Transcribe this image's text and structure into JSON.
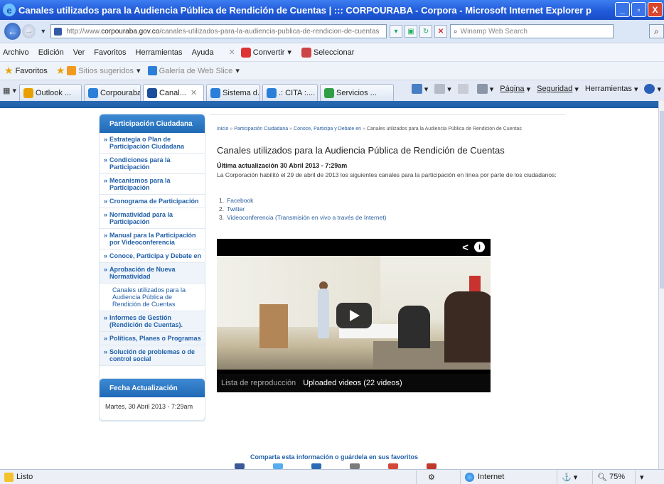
{
  "window": {
    "title": "Canales utilizados para la Audiencia Pública de Rendición de Cuentas | ::: CORPOURABA - Corpora - Microsoft Internet Explorer p",
    "minimize": "_",
    "maximize": "▫",
    "close": "X"
  },
  "address": {
    "prefix": "http://www.",
    "domain": "corpouraba.gov.co",
    "path": "/canales-utilizados-para-la-audiencia-publica-de-rendicion-de-cuentas",
    "search_placeholder": "Winamp Web Search"
  },
  "menubar": {
    "items": [
      "Archivo",
      "Edición",
      "Ver",
      "Favoritos",
      "Herramientas",
      "Ayuda"
    ],
    "convertir": "Convertir",
    "seleccionar": "Seleccionar"
  },
  "favorites": {
    "label": "Favoritos",
    "sitios": "Sitios sugeridos",
    "galeria": "Galería de Web Slice"
  },
  "tabs": [
    {
      "label": "Outlook ...",
      "color": "#e8a000"
    },
    {
      "label": "Corpouraba",
      "color": "#2b7fd8"
    },
    {
      "label": "Canal...",
      "color": "#1b4f9e"
    },
    {
      "label": "Sistema d...",
      "color": "#2b7fd8"
    },
    {
      "label": ".: CITA :....",
      "color": "#2b7fd8"
    },
    {
      "label": "Servicios ...",
      "color": "#2f9e44"
    }
  ],
  "commandbar": {
    "pagina": "Página",
    "seguridad": "Seguridad",
    "herramientas": "Herramientas"
  },
  "sidebar": {
    "title": "Participación Ciudadana",
    "items": [
      {
        "label": "Estrategia o Plan de Participación Ciudadana",
        "kind": "top"
      },
      {
        "label": "Condiciones para la Participación",
        "kind": "top"
      },
      {
        "label": "Mecanismos para la Participación",
        "kind": "top"
      },
      {
        "label": "Cronograma de Participación",
        "kind": "top"
      },
      {
        "label": "Normatividad para la Participación",
        "kind": "top"
      },
      {
        "label": "Manual para la Participación por Videoconferencia",
        "kind": "top"
      },
      {
        "label": "Conoce, Participa y Debate en",
        "kind": "top"
      },
      {
        "label": "Aprobación de Nueva Normatividad",
        "kind": "sub"
      },
      {
        "label": "Canales utilizados para la Audiencia Pública de Rendición de Cuentas",
        "kind": "current"
      },
      {
        "label": "Informes de Gestión (Rendición de Cuentas).",
        "kind": "sub"
      },
      {
        "label": "Políticas, Planes o Programas",
        "kind": "sub"
      },
      {
        "label": "Solución de problemas o de control social",
        "kind": "sub"
      }
    ]
  },
  "datebox": {
    "title": "Fecha Actualización",
    "value": "Martes, 30 Abril 2013 - 7:29am"
  },
  "breadcrumb": {
    "items": [
      "Inicio",
      "Participación Ciudadana",
      "Conoce, Participa y Debate en",
      "Canales utilizados para la Audiencia Pública de Rendición de Cuentas"
    ],
    "sep": "»"
  },
  "article": {
    "title": "Canales utilizados para la Audiencia Pública de Rendición de Cuentas",
    "updated": "Última actualización 30 Abril 2013 - 7:29am",
    "body": "La Corporación habilitó el 29 de abril de 2013 los siguientes canales para la participación en línea por parte de los ciudadanos:",
    "list": [
      "Facebook",
      "Twitter",
      "Videoconferencia (Transmisión en vivo a través de Internet)"
    ]
  },
  "video": {
    "playlist_label": "Lista de reproducción",
    "playlist_name": "Uploaded videos (22 videos)",
    "share_glyph": "<",
    "info_glyph": "i"
  },
  "share": {
    "text": "Comparta esta información o guárdela en sus favoritos",
    "icon_colors": [
      "#3b5998",
      "#55acee",
      "#2a6ab3",
      "#7b7b7b",
      "#d34836",
      "#c0392b"
    ]
  },
  "status": {
    "text": "Listo",
    "zone": "Internet",
    "zoom": "75%"
  }
}
